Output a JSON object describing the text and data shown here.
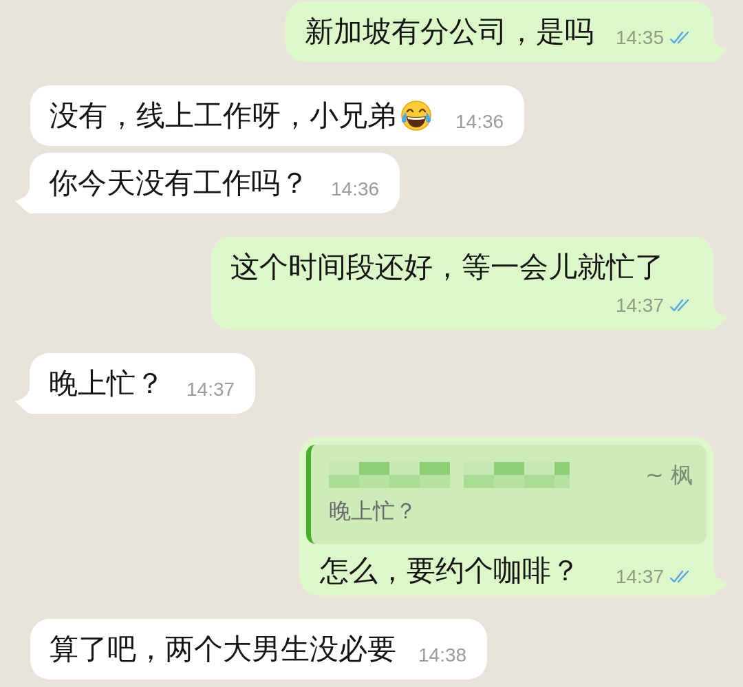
{
  "messages": [
    {
      "kind": "outgoing",
      "text": "新加坡有分公司，是吗",
      "time": "14:35",
      "read": true,
      "tail": true
    },
    {
      "kind": "incoming",
      "text": "没有，线上工作呀，小兄弟",
      "emoji": true,
      "time": "14:36",
      "tail": false
    },
    {
      "kind": "incoming",
      "text": "你今天没有工作吗？",
      "time": "14:36",
      "tail": true
    },
    {
      "kind": "outgoing",
      "text": "这个时间段还好，等一会儿就忙了",
      "time": "14:37",
      "read": true,
      "tail": true
    },
    {
      "kind": "incoming",
      "text": "晚上忙？",
      "time": "14:37",
      "tail": true
    },
    {
      "kind": "outgoing",
      "quote": {
        "author": "~ 枫",
        "text": "晚上忙？"
      },
      "text": "怎么，要约个咖啡？",
      "time": "14:37",
      "read": true,
      "tail": true
    },
    {
      "kind": "incoming",
      "text": "算了吧，两个大男生没必要",
      "time": "14:38",
      "tail": false
    }
  ]
}
